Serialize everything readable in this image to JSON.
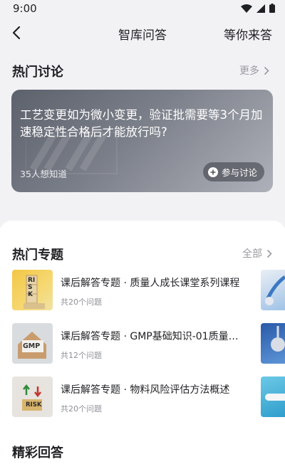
{
  "status_bar": {
    "time": "9:00"
  },
  "nav": {
    "title": "智库问答",
    "action": "等你来答"
  },
  "hot_discussion": {
    "title": "热门讨论",
    "more": "更多",
    "card": {
      "question": "工艺变更如为微小变更，验证批需要等3个月加速稳定性合格后才能放行吗?",
      "count": "35人想知道",
      "join": "参与讨论"
    }
  },
  "hot_topics": {
    "title": "热门专题",
    "all": "全部",
    "items": [
      {
        "title": "课后解答专题 · 质量人成长课堂系列课程",
        "count": "共20个问题",
        "thumb_text": "RISK"
      },
      {
        "title": "课后解答专题 · GMP基础知识-01质量管理",
        "count": "共12个问题",
        "thumb_text": "GMP"
      },
      {
        "title": "课后解答专题 · 物料风险评估方法概述",
        "count": "共20个问题",
        "thumb_text": "RISK"
      }
    ]
  },
  "featured_answers": {
    "title": "精彩回答"
  }
}
